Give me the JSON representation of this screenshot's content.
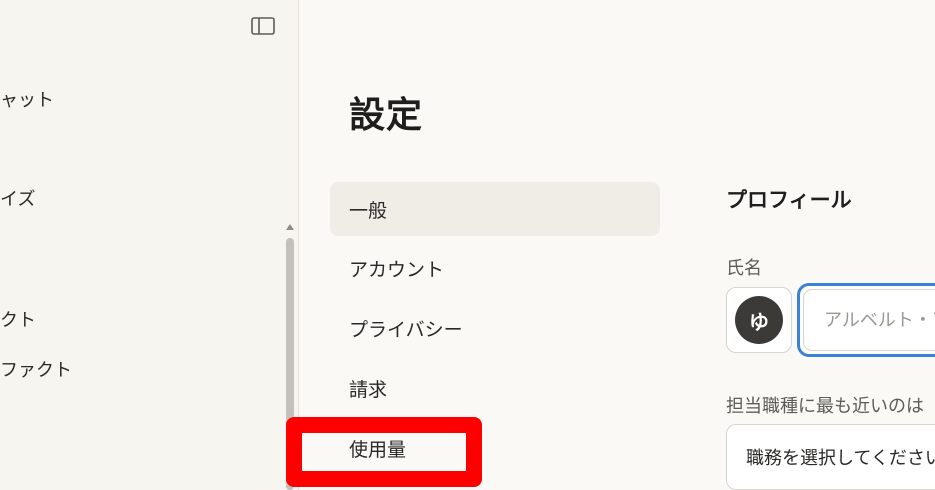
{
  "sidebar": {
    "toggle_icon": "sidebar-toggle-icon",
    "items": [
      {
        "label": "ャット"
      },
      {
        "label": "イズ"
      },
      {
        "label": "クト"
      },
      {
        "label": "ファクト"
      }
    ]
  },
  "main": {
    "title": "設定",
    "nav": [
      {
        "label": "一般",
        "active": true
      },
      {
        "label": "アカウント"
      },
      {
        "label": "プライバシー"
      },
      {
        "label": "請求"
      },
      {
        "label": "使用量"
      }
    ]
  },
  "profile": {
    "section_title": "プロフィール",
    "name_label": "氏名",
    "avatar_initial": "ゆ",
    "name_placeholder": "アルベルト・アイ",
    "job_label": "担当職種に最も近いのは",
    "job_select_value": "職務を選択してください"
  },
  "colors": {
    "highlight": "#ff0000",
    "focus_ring": "#3b82d6",
    "active_nav": "#f0ede6"
  }
}
